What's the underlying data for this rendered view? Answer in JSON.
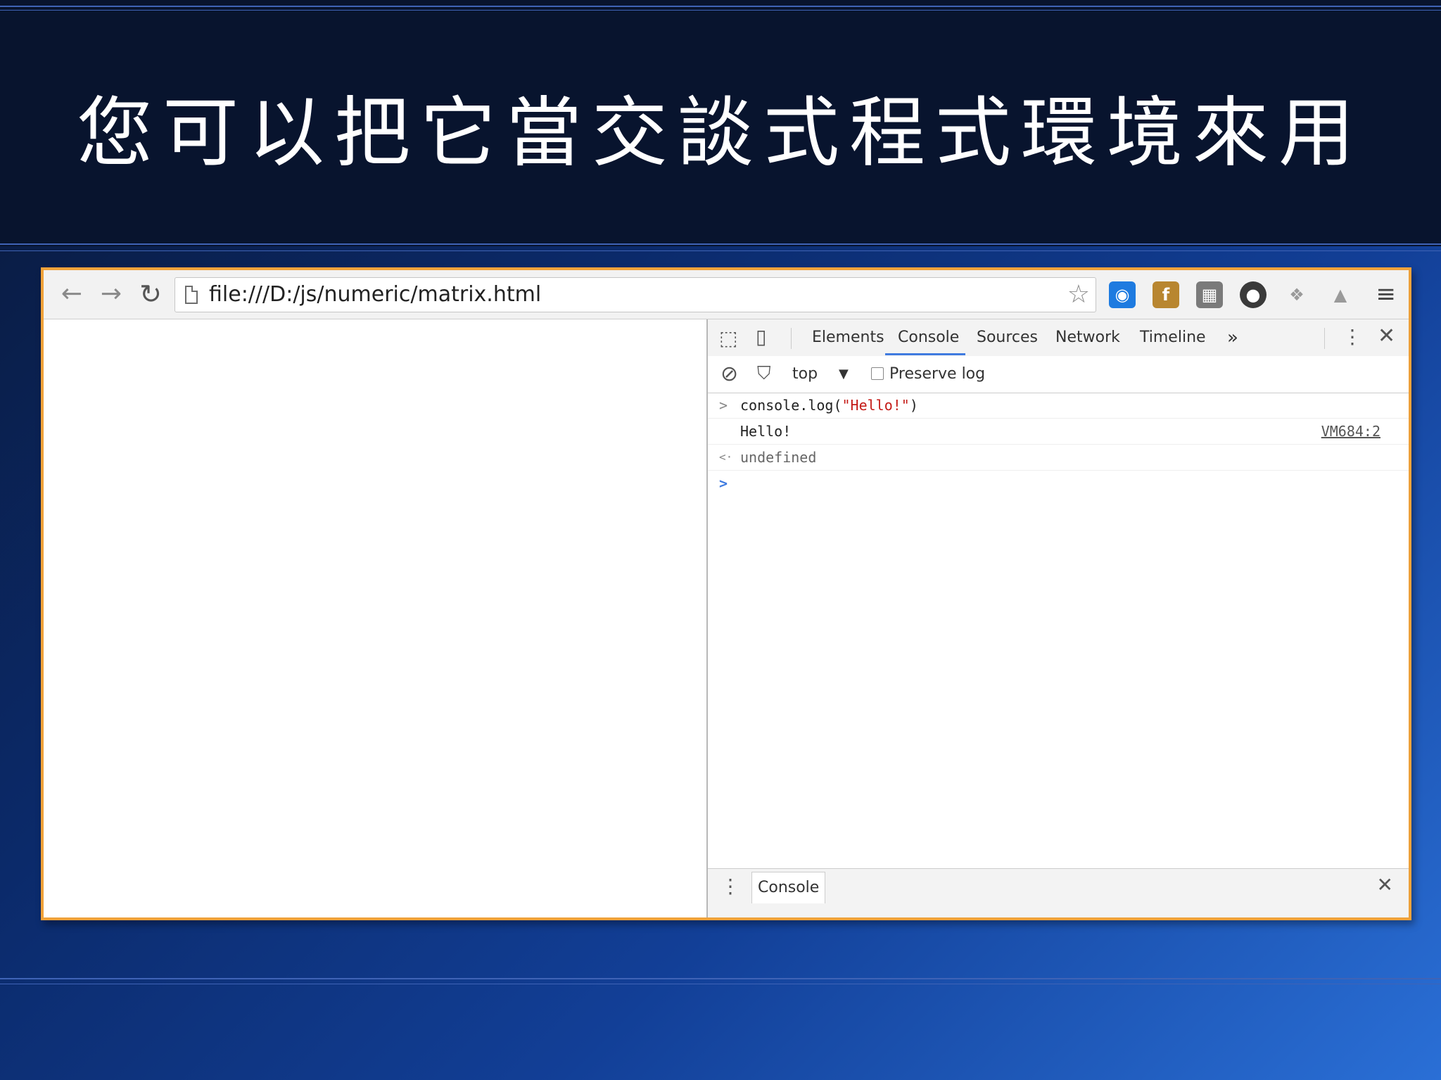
{
  "slide": {
    "title": "您可以把它當交談式程式環境來用"
  },
  "browser": {
    "url": "file:///D:/js/numeric/matrix.html",
    "extensions": [
      {
        "name": "extension-1-icon",
        "color": "#1e7be0",
        "glyph": "◉"
      },
      {
        "name": "facebook-extension-icon",
        "color": "#b88630",
        "glyph": "f"
      },
      {
        "name": "keyboard-extension-icon",
        "color": "#7a7a7a",
        "glyph": "▦"
      },
      {
        "name": "extension-4-icon",
        "color": "#3a3a3a",
        "glyph": "●"
      },
      {
        "name": "dropbox-icon",
        "color": "#9a9a9a",
        "glyph": "❖"
      },
      {
        "name": "google-drive-icon",
        "color": "#9a9a9a",
        "glyph": "▲"
      }
    ]
  },
  "devtools": {
    "tabs": [
      "Elements",
      "Console",
      "Sources",
      "Network",
      "Timeline"
    ],
    "more_tabs": "»",
    "filter": {
      "context": "top",
      "preserve_log": "Preserve log"
    },
    "console": {
      "input_prefix": ">",
      "cmd_pre": "console.log(",
      "cmd_str": "\"Hello!\"",
      "cmd_post": ")",
      "output": "Hello!",
      "source": "VM684:2",
      "result_prefix": "<·",
      "result": "undefined",
      "prompt": ">"
    },
    "drawer_tab": "Console"
  }
}
